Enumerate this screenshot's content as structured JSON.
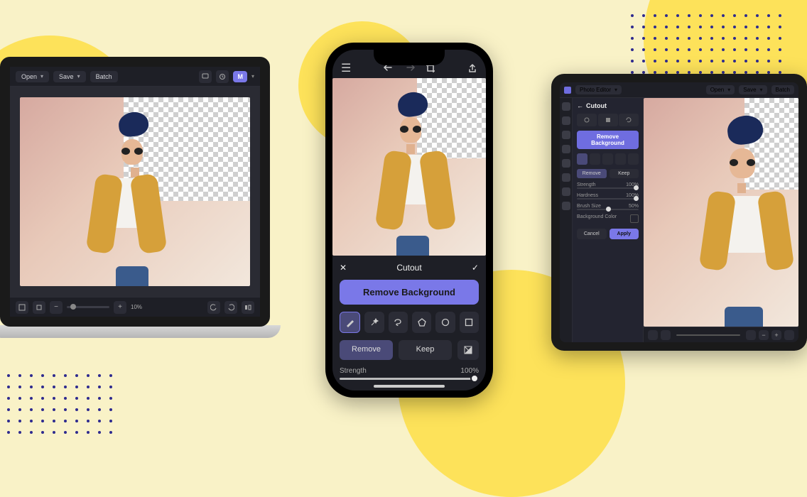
{
  "colors": {
    "accent": "#7A78E8",
    "bg_dark": "#1E1F26",
    "bg_page": "#F9F2C7"
  },
  "laptop": {
    "open_label": "Open",
    "save_label": "Save",
    "batch_label": "Batch",
    "user_initial": "M",
    "zoom_pct": "10%"
  },
  "phone": {
    "title": "Cutout",
    "remove_bg_label": "Remove Background",
    "seg_remove": "Remove",
    "seg_keep": "Keep",
    "slider_label": "Strength",
    "slider_value": "100%",
    "tools": [
      "brush",
      "magic",
      "lasso",
      "polygon",
      "circle",
      "rect"
    ]
  },
  "tablet": {
    "mode_label": "Photo Editor",
    "open_label": "Open",
    "save_label": "Save",
    "batch_label": "Batch",
    "panel_title": "Cutout",
    "remove_bg_label": "Remove Background",
    "seg_remove": "Remove",
    "seg_keep": "Keep",
    "sl1_label": "Strength",
    "sl1_value": "100%",
    "sl2_label": "Hardness",
    "sl2_value": "100%",
    "sl3_label": "Brush Size",
    "sl3_value": "50%",
    "bgcolor_label": "Background Color",
    "cancel_label": "Cancel",
    "apply_label": "Apply"
  }
}
